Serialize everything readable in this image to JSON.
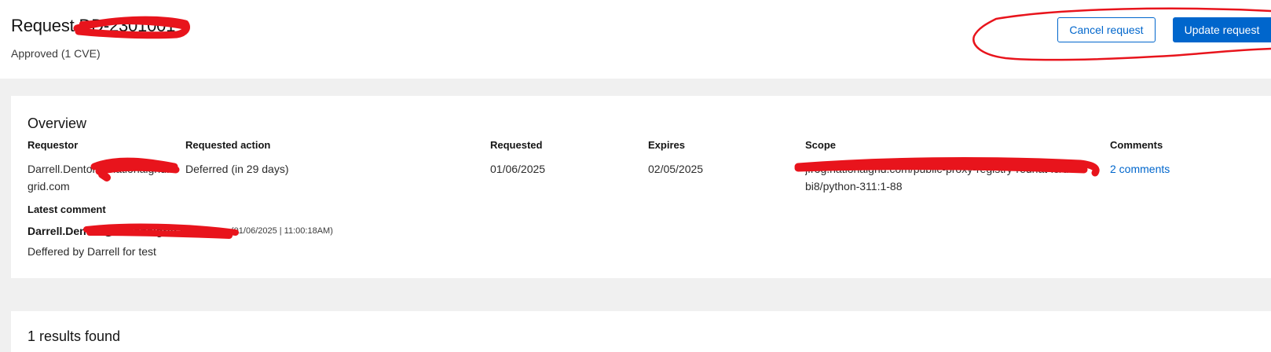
{
  "header": {
    "title": "Request DD-2301001",
    "subtitle": "Approved (1 CVE)",
    "cancel_label": "Cancel request",
    "update_label": "Update request"
  },
  "overview": {
    "title": "Overview",
    "fields": {
      "requestor_label": "Requestor",
      "requestor_value_line1": "Darrell.Denton@nationalgrid.",
      "requestor_value_line2": "grid.com",
      "action_label": "Requested action",
      "action_value": "Deferred (in 29 days)",
      "requested_label": "Requested",
      "requested_value": "01/06/2025",
      "expires_label": "Expires",
      "expires_value": "02/05/2025",
      "scope_label": "Scope",
      "scope_value_line1": "jfrog.nationalgrid.com/public-proxy-registry-redhat-io/u",
      "scope_value_line2": "bi8/python-311:1-88",
      "comments_label": "Comments",
      "comments_value": "2 comments"
    },
    "latest_comment": {
      "label": "Latest comment",
      "author": "Darrell.Denton@nationalgrid.com",
      "timestamp": "(01/06/2025 | 11:00:18AM)",
      "text": "Deffered by Darrell for test"
    }
  },
  "results": {
    "count_text": "1 results found"
  },
  "colors": {
    "accent": "#0066cc",
    "redaction": "#e8141c",
    "page_bg": "#f0f0f0"
  }
}
